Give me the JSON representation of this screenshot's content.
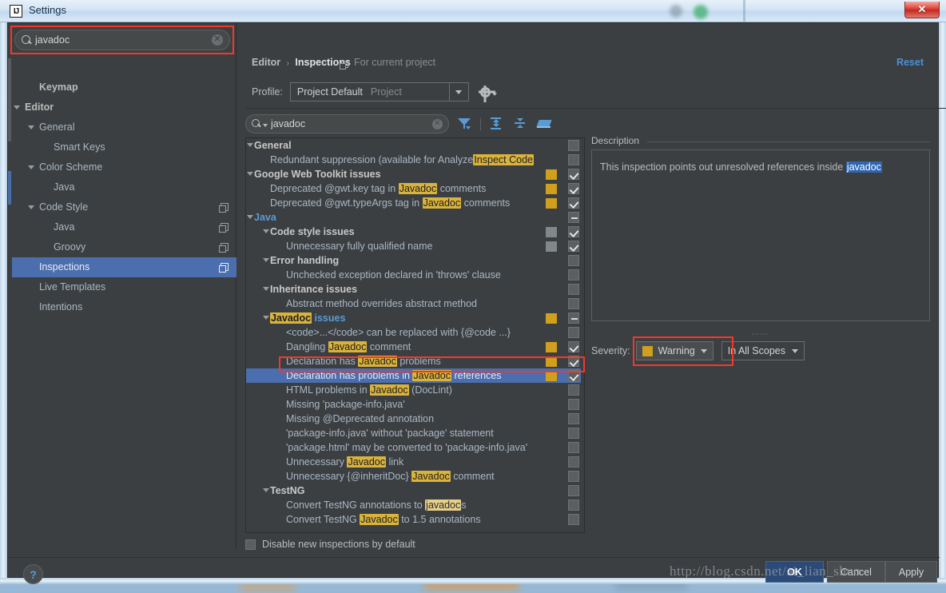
{
  "window": {
    "title": "Settings",
    "app_icon": "IJ",
    "close_label": "✕"
  },
  "sidebar": {
    "search": {
      "value": "javadoc",
      "placeholder": "",
      "icon": "search-icon",
      "clear_icon": "clear-icon"
    },
    "items": [
      {
        "label": "Keymap",
        "indent": 1,
        "arrow": false,
        "bold": true,
        "copy": false,
        "selected": false
      },
      {
        "label": "Editor",
        "indent": 0,
        "arrow": true,
        "bold": true,
        "copy": false,
        "selected": false
      },
      {
        "label": "General",
        "indent": 1,
        "arrow": true,
        "bold": false,
        "copy": false,
        "selected": false
      },
      {
        "label": "Smart Keys",
        "indent": 2,
        "arrow": false,
        "bold": false,
        "copy": false,
        "selected": false
      },
      {
        "label": "Color Scheme",
        "indent": 1,
        "arrow": true,
        "bold": false,
        "copy": false,
        "selected": false
      },
      {
        "label": "Java",
        "indent": 2,
        "arrow": false,
        "bold": false,
        "copy": false,
        "selected": false
      },
      {
        "label": "Code Style",
        "indent": 1,
        "arrow": true,
        "bold": false,
        "copy": true,
        "selected": false
      },
      {
        "label": "Java",
        "indent": 2,
        "arrow": false,
        "bold": false,
        "copy": true,
        "selected": false
      },
      {
        "label": "Groovy",
        "indent": 2,
        "arrow": false,
        "bold": false,
        "copy": true,
        "selected": false
      },
      {
        "label": "Inspections",
        "indent": 1,
        "arrow": false,
        "bold": false,
        "copy": true,
        "selected": true
      },
      {
        "label": "Live Templates",
        "indent": 1,
        "arrow": false,
        "bold": false,
        "copy": false,
        "selected": false
      },
      {
        "label": "Intentions",
        "indent": 1,
        "arrow": false,
        "bold": false,
        "copy": false,
        "selected": false
      }
    ]
  },
  "main": {
    "breadcrumb": {
      "parent": "Editor",
      "separator": "›",
      "current": "Inspections",
      "scope_note": "For current project"
    },
    "reset_label": "Reset",
    "profile": {
      "label": "Profile:",
      "name": "Project Default",
      "kind": "Project",
      "dropdown_icon": "chevron-down-icon",
      "gear_icon": "gear-icon"
    },
    "filter": {
      "value": "javadoc",
      "search_icon": "search-dropdown-icon",
      "clear_icon": "clear-icon",
      "tools": [
        "filter-funnel-icon",
        "expand-all-icon",
        "collapse-all-icon",
        "reset-inspections-icon"
      ]
    },
    "tree": [
      {
        "text": "General",
        "indent": 0,
        "arrow": true,
        "style": "group",
        "sev": "none",
        "chk": "blank"
      },
      {
        "text": "Redundant suppression (available for Analyze|Inspect Code",
        "indent": 1,
        "arrow": false,
        "style": "leaf",
        "sev": "none",
        "chk": "blank"
      },
      {
        "text": "Google Web Toolkit issues",
        "indent": 0,
        "arrow": true,
        "style": "group",
        "sev": "gold",
        "chk": "checked"
      },
      {
        "text": "Deprecated @gwt.key tag in |Javadoc| comments",
        "indent": 1,
        "arrow": false,
        "style": "leaf",
        "sev": "gold",
        "chk": "checked",
        "highlight_label": "JavaDoc"
      },
      {
        "text": "Deprecated @gwt.typeArgs tag in |Javadoc| comments",
        "indent": 1,
        "arrow": false,
        "style": "leaf",
        "sev": "gold",
        "chk": "checked",
        "highlight_label": "JavaDoc"
      },
      {
        "text": "Java",
        "indent": 0,
        "arrow": true,
        "style": "blue",
        "sev": "none",
        "chk": "partial"
      },
      {
        "text": "Code style issues",
        "indent": 1,
        "arrow": true,
        "style": "group",
        "sev": "gray",
        "chk": "checked"
      },
      {
        "text": "Unnecessary fully qualified name",
        "indent": 2,
        "arrow": false,
        "style": "leaf",
        "sev": "gray",
        "chk": "checked"
      },
      {
        "text": "Error handling",
        "indent": 1,
        "arrow": true,
        "style": "group",
        "sev": "none",
        "chk": "blank"
      },
      {
        "text": "Unchecked exception declared in 'throws' clause",
        "indent": 2,
        "arrow": false,
        "style": "leaf",
        "sev": "none",
        "chk": "blank"
      },
      {
        "text": "Inheritance issues",
        "indent": 1,
        "arrow": true,
        "style": "group",
        "sev": "none",
        "chk": "blank"
      },
      {
        "text": "Abstract method overrides abstract method",
        "indent": 2,
        "arrow": false,
        "style": "leaf",
        "sev": "none",
        "chk": "blank"
      },
      {
        "text": "|Javadoc| issues",
        "indent": 1,
        "arrow": true,
        "style": "blue",
        "sev": "gold",
        "chk": "partial"
      },
      {
        "text": "<code>...</code> can be replaced with {@code ...}",
        "indent": 2,
        "arrow": false,
        "style": "leaf",
        "sev": "none",
        "chk": "blank"
      },
      {
        "text": "Dangling |Javadoc| comment",
        "indent": 2,
        "arrow": false,
        "style": "leaf",
        "sev": "gold",
        "chk": "checked"
      },
      {
        "text": "Declaration has |Javadoc| problems",
        "indent": 2,
        "arrow": false,
        "style": "leaf",
        "sev": "gold",
        "chk": "checked"
      },
      {
        "text": "Declaration has problems in |Javadoc| references",
        "indent": 2,
        "arrow": false,
        "style": "leaf",
        "sev": "gold",
        "chk": "checked",
        "selected": true
      },
      {
        "text": "HTML problems in |Javadoc| (DocLint)",
        "indent": 2,
        "arrow": false,
        "style": "leaf",
        "sev": "none",
        "chk": "blank"
      },
      {
        "text": "Missing 'package-info.java'",
        "indent": 2,
        "arrow": false,
        "style": "leaf",
        "sev": "none",
        "chk": "blank"
      },
      {
        "text": "Missing @Deprecated annotation",
        "indent": 2,
        "arrow": false,
        "style": "leaf",
        "sev": "none",
        "chk": "blank"
      },
      {
        "text": "'package-info.java' without 'package' statement",
        "indent": 2,
        "arrow": false,
        "style": "leaf",
        "sev": "none",
        "chk": "blank"
      },
      {
        "text": "'package.html' may be converted to 'package-info.java'",
        "indent": 2,
        "arrow": false,
        "style": "leaf",
        "sev": "none",
        "chk": "blank"
      },
      {
        "text": "Unnecessary |Javadoc| link",
        "indent": 2,
        "arrow": false,
        "style": "leaf",
        "sev": "none",
        "chk": "blank"
      },
      {
        "text": "Unnecessary {@inheritDoc} |Javadoc| comment",
        "indent": 2,
        "arrow": false,
        "style": "leaf",
        "sev": "none",
        "chk": "blank"
      },
      {
        "text": "TestNG",
        "indent": 1,
        "arrow": true,
        "style": "group",
        "sev": "none",
        "chk": "blank"
      },
      {
        "text": "Convert TestNG annotations to |javadoc|s",
        "indent": 2,
        "arrow": false,
        "style": "leaf",
        "sev": "none",
        "chk": "blank",
        "soft": true
      },
      {
        "text": "Convert TestNG |Javadoc| to 1.5 annotations",
        "indent": 2,
        "arrow": false,
        "style": "leaf",
        "sev": "none",
        "chk": "blank"
      }
    ],
    "description": {
      "legend": "Description",
      "text_before": "This inspection points out unresolved references inside ",
      "highlighted_word": "javadoc"
    },
    "severity": {
      "label": "Severity:",
      "value": "Warning",
      "swatch_color": "#cf9f1d",
      "dropdown_icon": "chevron-down-icon",
      "scope_value": "In All Scopes",
      "scope_dropdown_icon": "chevron-down-icon"
    },
    "disable_new": {
      "label": "Disable new inspections by default",
      "checked": false
    }
  },
  "footer": {
    "help_icon": "?",
    "ok_label": "OK",
    "cancel_label": "Cancel",
    "apply_label": "Apply"
  },
  "watermark": "http://blog.csdn.net/ai_lian_shuo",
  "colors": {
    "accent_blue": "#4b6eaf",
    "link_blue": "#4a90d9",
    "highlight_gold": "#d9b33c",
    "severity_warning": "#cf9f1d",
    "annotation_red": "#f5372b",
    "panel_bg": "#3c3f41"
  }
}
